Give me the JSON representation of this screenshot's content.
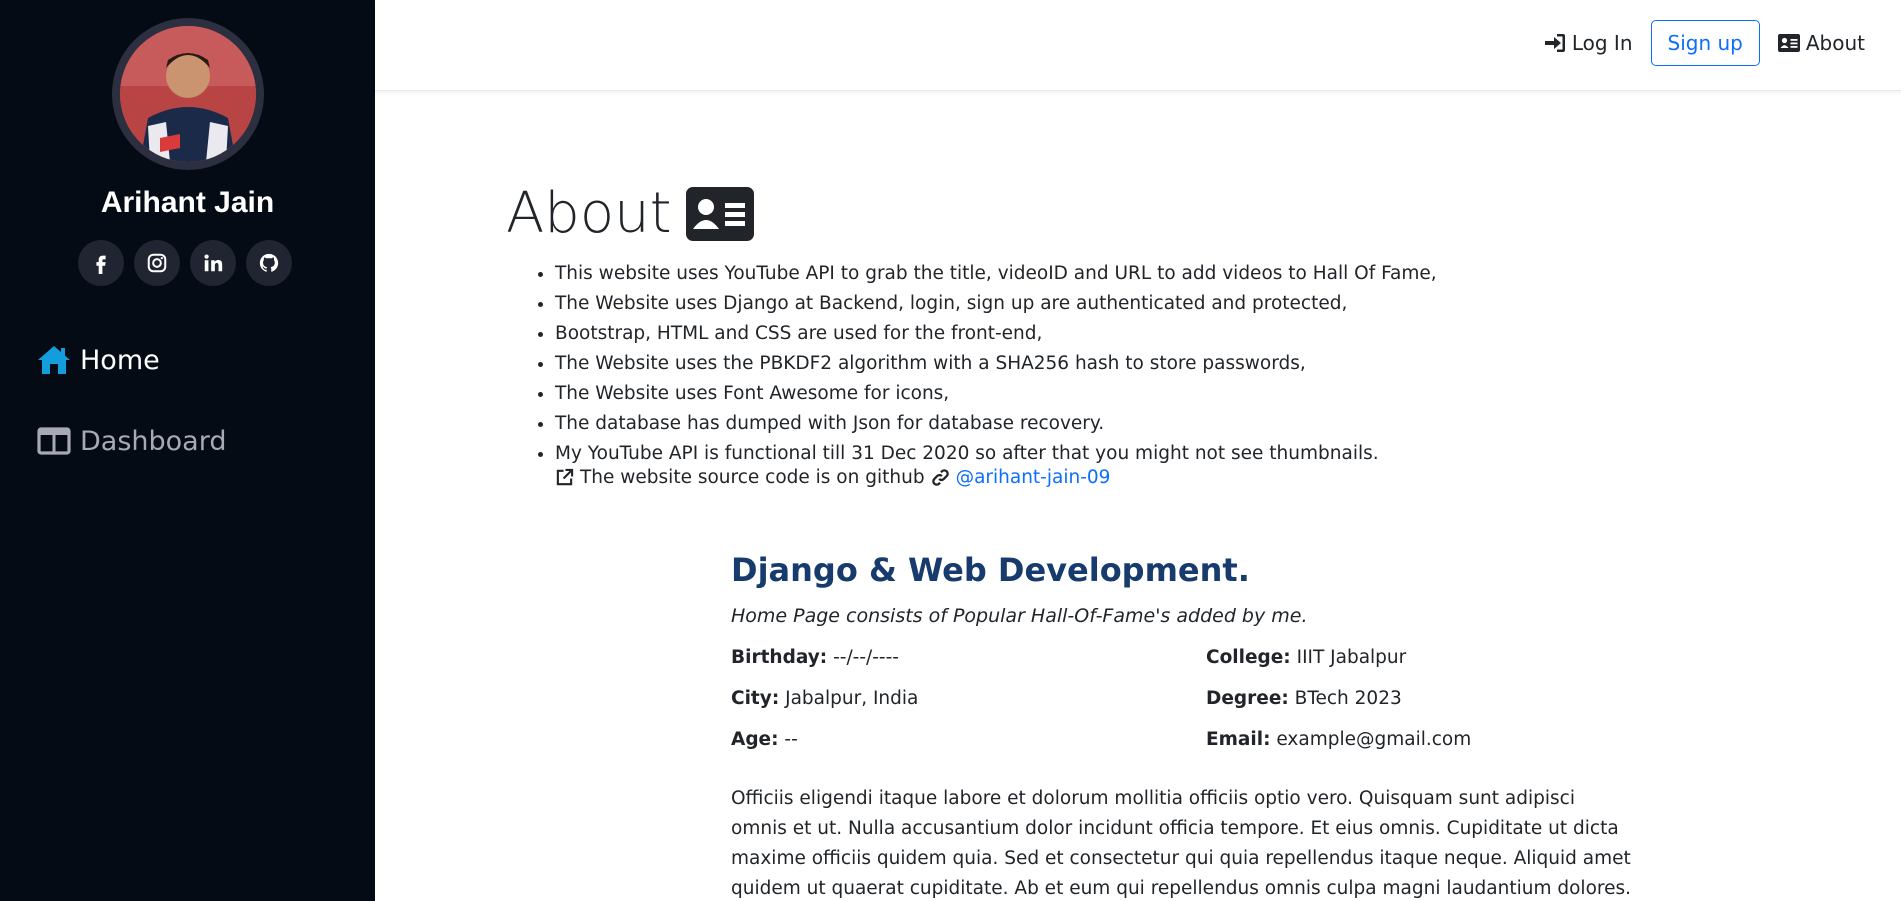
{
  "profile": {
    "name": "Arihant Jain",
    "social": [
      {
        "name": "facebook-icon",
        "glyph": "f"
      },
      {
        "name": "instagram-icon",
        "glyph": ""
      },
      {
        "name": "linkedin-icon",
        "glyph": "in"
      },
      {
        "name": "github-icon",
        "glyph": ""
      }
    ]
  },
  "sidebar": {
    "items": [
      {
        "label": "Home",
        "icon": "home-icon",
        "active": true
      },
      {
        "label": "Dashboard",
        "icon": "dashboard-icon",
        "active": false
      }
    ]
  },
  "topnav": {
    "login_label": "Log In",
    "signup_label": "Sign up",
    "about_label": "About"
  },
  "page": {
    "title": "About",
    "bullets": [
      "This website uses YouTube API to grab the title, videoID and URL to add videos to Hall Of Fame,",
      "The Website uses Django at Backend, login, sign up are authenticated and protected,",
      "Bootstrap, HTML and CSS are used for the front-end,",
      "The Website uses the PBKDF2 algorithm with a SHA256 hash to store passwords,",
      "The Website uses Font Awesome for icons,",
      "The database has dumped with Json for database recovery.",
      "My YouTube API is functional till 31 Dec 2020 so after that you might not see thumbnails."
    ],
    "source_text": "The website source code is on github",
    "source_link": "@arihant-jain-09"
  },
  "section": {
    "heading": "Django & Web Development.",
    "subtitle": "Home Page consists of Popular Hall-Of-Fame's added by me.",
    "birthday_label": "Birthday:",
    "birthday_value": "--/--/----",
    "college_label": "College:",
    "college_value": "IIIT Jabalpur",
    "city_label": "City:",
    "city_value": "Jabalpur, India",
    "degree_label": "Degree:",
    "degree_value": "BTech 2023",
    "age_label": "Age:",
    "age_value": "--",
    "email_label": "Email:",
    "email_value": "example@gmail.com",
    "description": "Officiis eligendi itaque labore et dolorum mollitia officiis optio vero. Quisquam sunt adipisci omnis et ut. Nulla accusantium dolor incidunt officia tempore. Et eius omnis. Cupiditate ut dicta maxime officiis quidem quia. Sed et consectetur qui quia repellendus itaque neque. Aliquid amet quidem ut quaerat cupiditate. Ab et eum qui repellendus omnis culpa magni laudantium dolores."
  },
  "colors": {
    "sidebar_bg": "#040b14",
    "accent": "#0d6efd",
    "heading": "#173b6c",
    "home_icon": "#149ddd"
  }
}
